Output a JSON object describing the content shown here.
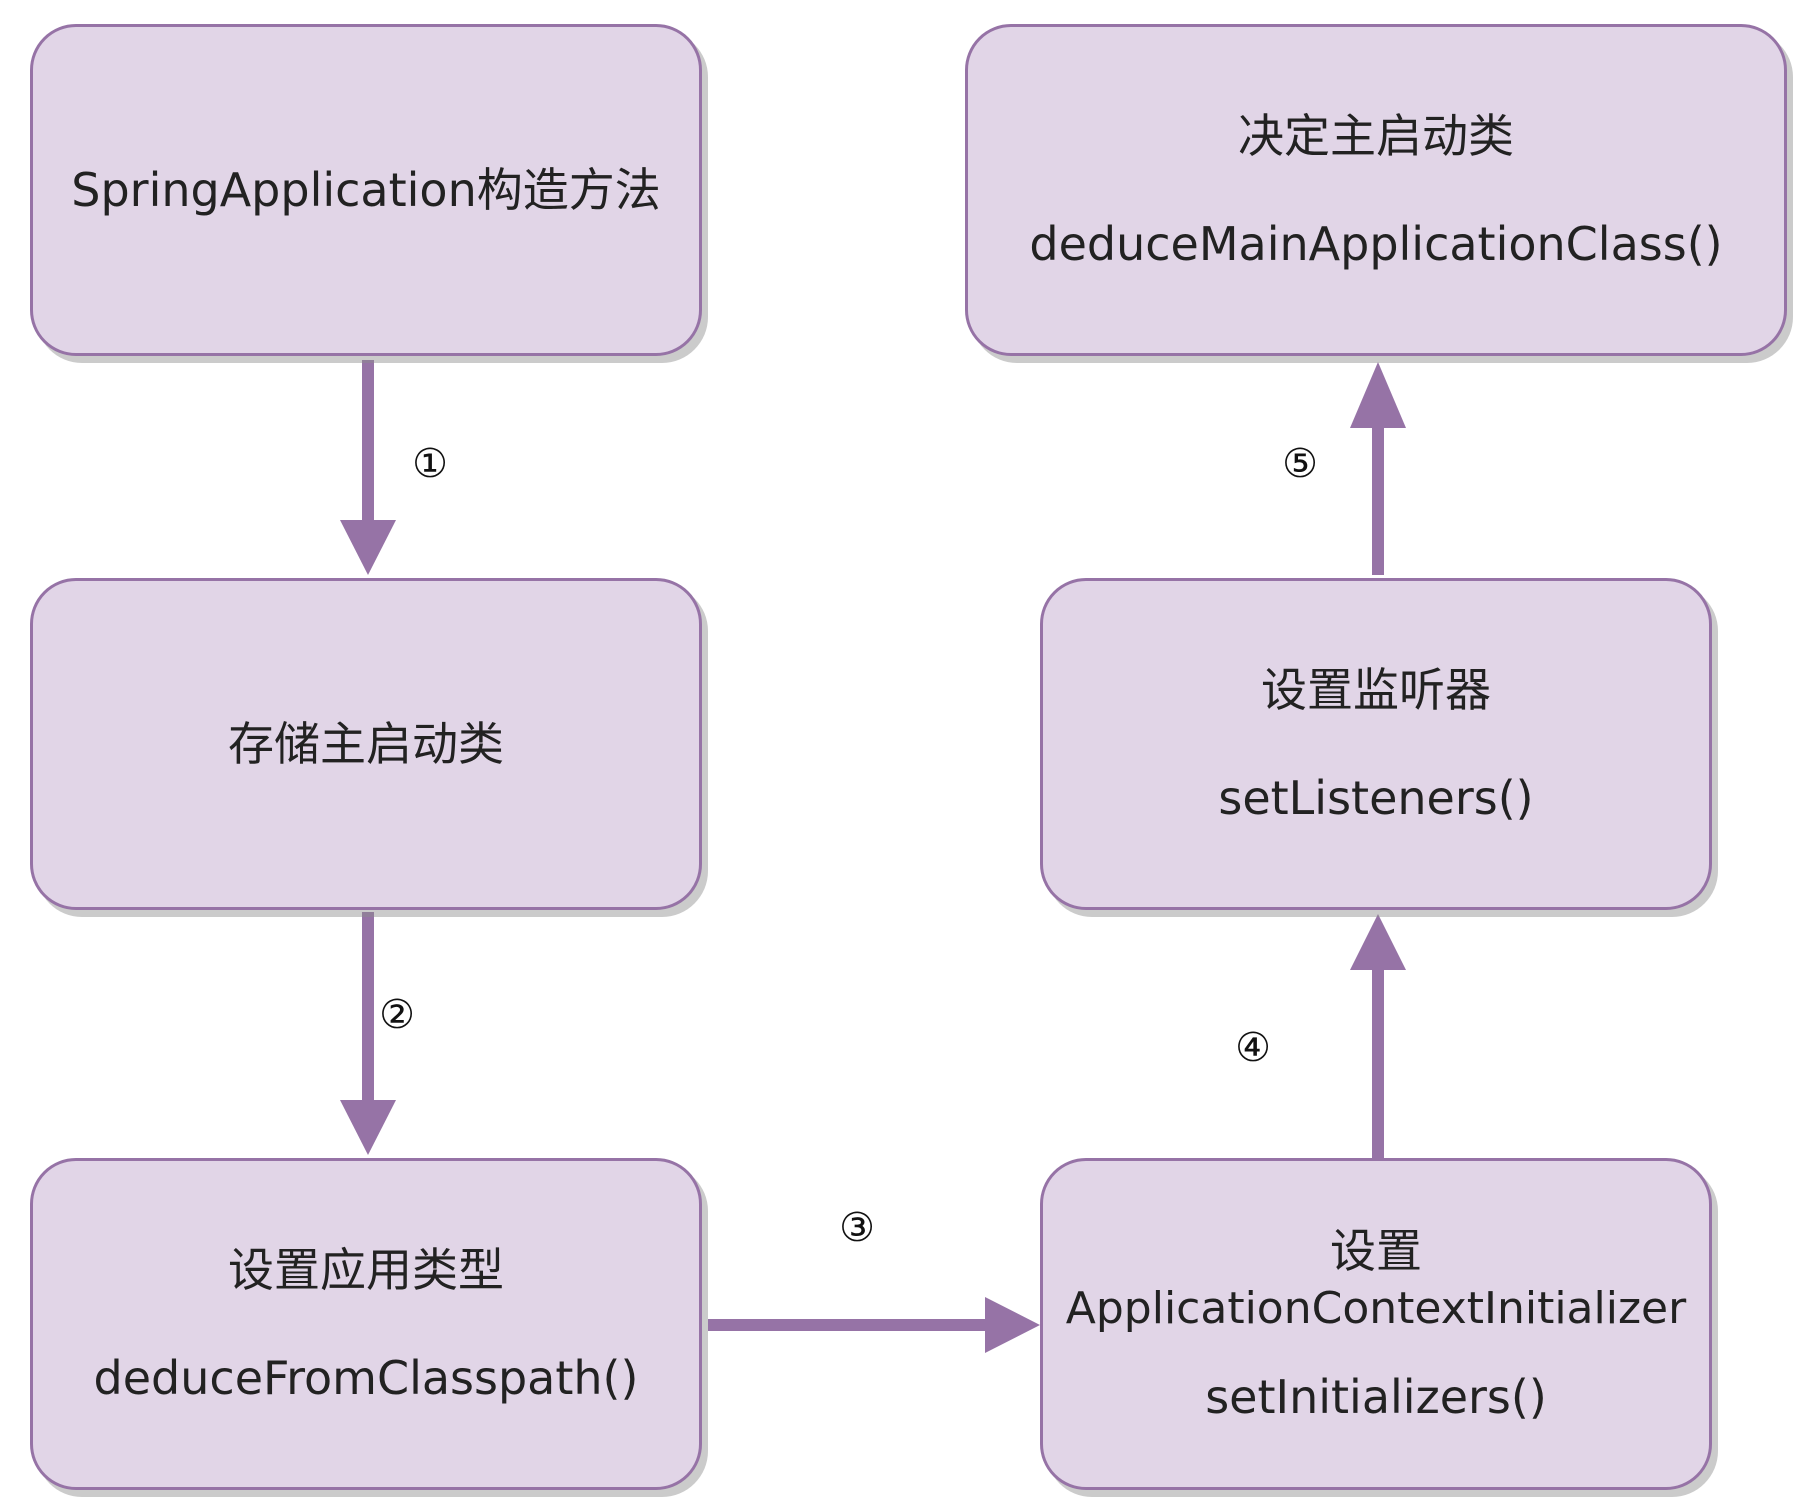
{
  "nodes": {
    "constructor": {
      "line1": "SpringApplication构造方法"
    },
    "store_main": {
      "line1": "存储主启动类"
    },
    "app_type": {
      "line1": "设置应用类型",
      "line2": "deduceFromClasspath()"
    },
    "initializers": {
      "line1": "设置",
      "line2": "ApplicationContextInitializer",
      "line3": "setInitializers()"
    },
    "listeners": {
      "line1": "设置监听器",
      "line2": "setListeners()"
    },
    "main_class": {
      "line1": "决定主启动类",
      "line2": "deduceMainApplicationClass()"
    }
  },
  "edges": {
    "e1": {
      "label": "①"
    },
    "e2": {
      "label": "②"
    },
    "e3": {
      "label": "③"
    },
    "e4": {
      "label": "④"
    },
    "e5": {
      "label": "⑤"
    }
  },
  "colors": {
    "node_fill": "#e1d5e7",
    "node_stroke": "#9673a6",
    "edge": "#9673a6"
  }
}
